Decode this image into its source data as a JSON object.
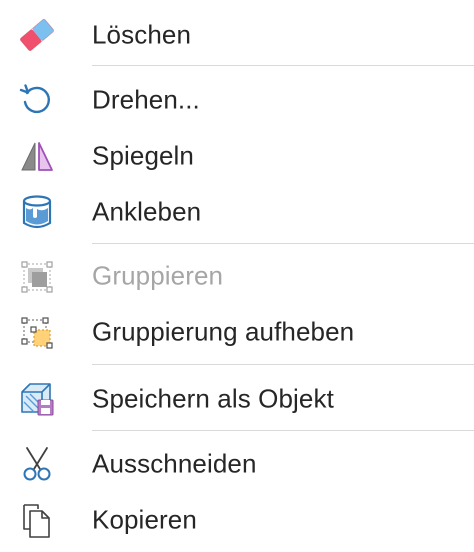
{
  "menu": {
    "items": [
      {
        "label": "Löschen",
        "icon": "eraser-icon",
        "enabled": true
      },
      {
        "label": "Drehen...",
        "icon": "rotate-icon",
        "enabled": true
      },
      {
        "label": "Spiegeln",
        "icon": "mirror-icon",
        "enabled": true
      },
      {
        "label": "Ankleben",
        "icon": "glue-icon",
        "enabled": true
      },
      {
        "label": "Gruppieren",
        "icon": "group-icon",
        "enabled": false
      },
      {
        "label": "Gruppierung aufheben",
        "icon": "ungroup-icon",
        "enabled": true
      },
      {
        "label": "Speichern als Objekt",
        "icon": "save-object-icon",
        "enabled": true
      },
      {
        "label": "Ausschneiden",
        "icon": "scissors-icon",
        "enabled": true
      },
      {
        "label": "Kopieren",
        "icon": "copy-icon",
        "enabled": true
      }
    ]
  },
  "colors": {
    "text": "#262626",
    "disabled_text": "#a6a6a6",
    "separator": "#d9d9d9",
    "accent_blue": "#2e75b6",
    "accent_purple": "#b57cc4",
    "eraser_red": "#f0506e",
    "eraser_blue": "#7cc0f0"
  }
}
